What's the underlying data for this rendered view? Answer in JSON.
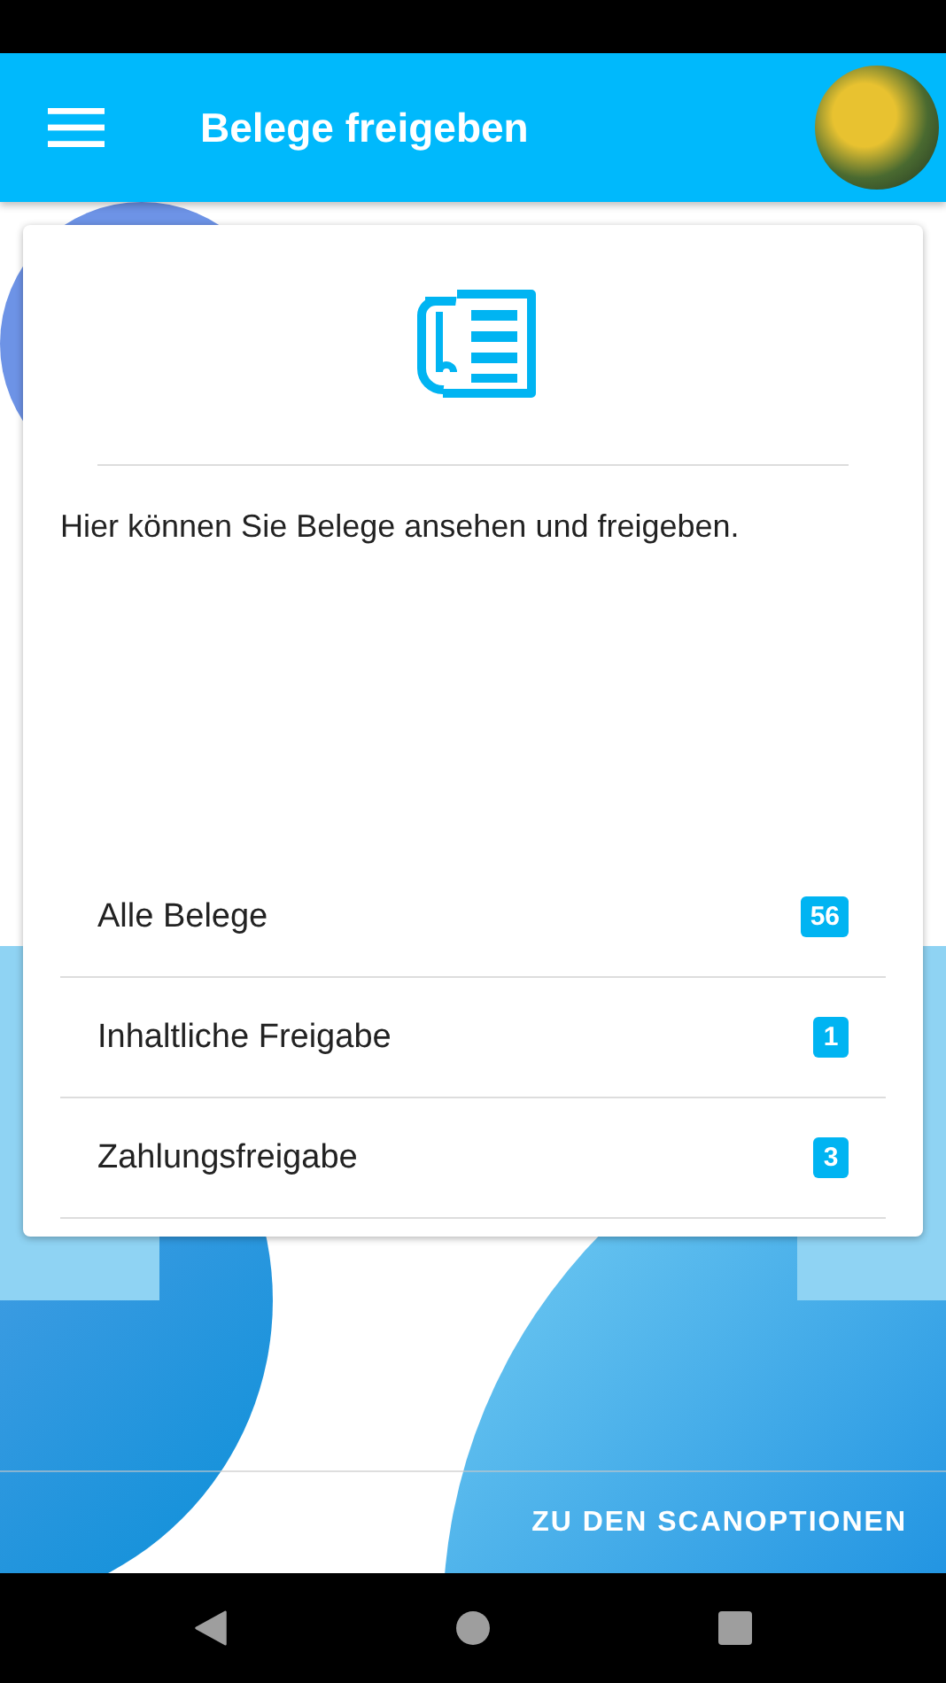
{
  "app_bar": {
    "title": "Belege freigeben"
  },
  "card": {
    "description": "Hier können Sie Belege ansehen und freigeben.",
    "items": [
      {
        "label": "Alle Belege",
        "count": "56"
      },
      {
        "label": "Inhaltliche Freigabe",
        "count": "1"
      },
      {
        "label": "Zahlungsfreigabe",
        "count": "3"
      }
    ]
  },
  "footer": {
    "button": "ZU DEN SCANOPTIONEN"
  }
}
